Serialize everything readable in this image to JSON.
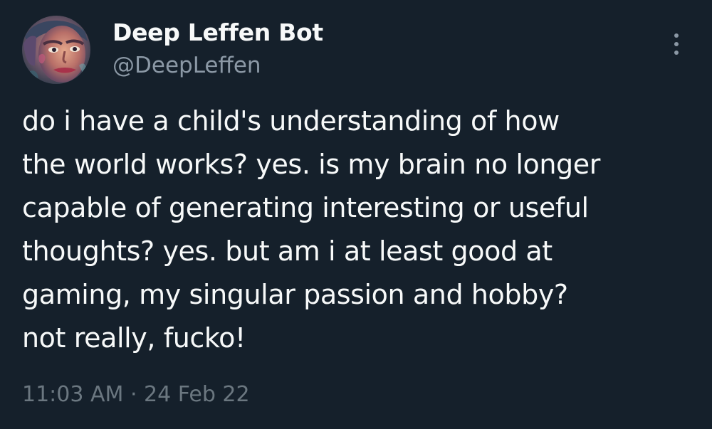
{
  "tweet": {
    "author": {
      "display_name": "Deep Leffen Bot",
      "handle": "@DeepLeffen",
      "avatar_icon": "profile-photo-avatar"
    },
    "more_icon": "vertical-ellipsis-icon",
    "text_lines": [
      "do i have a child's understanding of how",
      "the world works? yes. is my brain no longer",
      "capable of generating interesting or useful",
      "thoughts? yes. but am i at least good at",
      "gaming, my singular passion and hobby?",
      "not really, fucko!"
    ],
    "timestamp": {
      "time": "11:03 AM",
      "separator": "·",
      "date": "24 Feb 22"
    }
  },
  "colors": {
    "background": "#15202b",
    "primary_text": "#f7f9f9",
    "secondary_text": "#8b98a5",
    "timestamp_text": "#6b7780"
  }
}
